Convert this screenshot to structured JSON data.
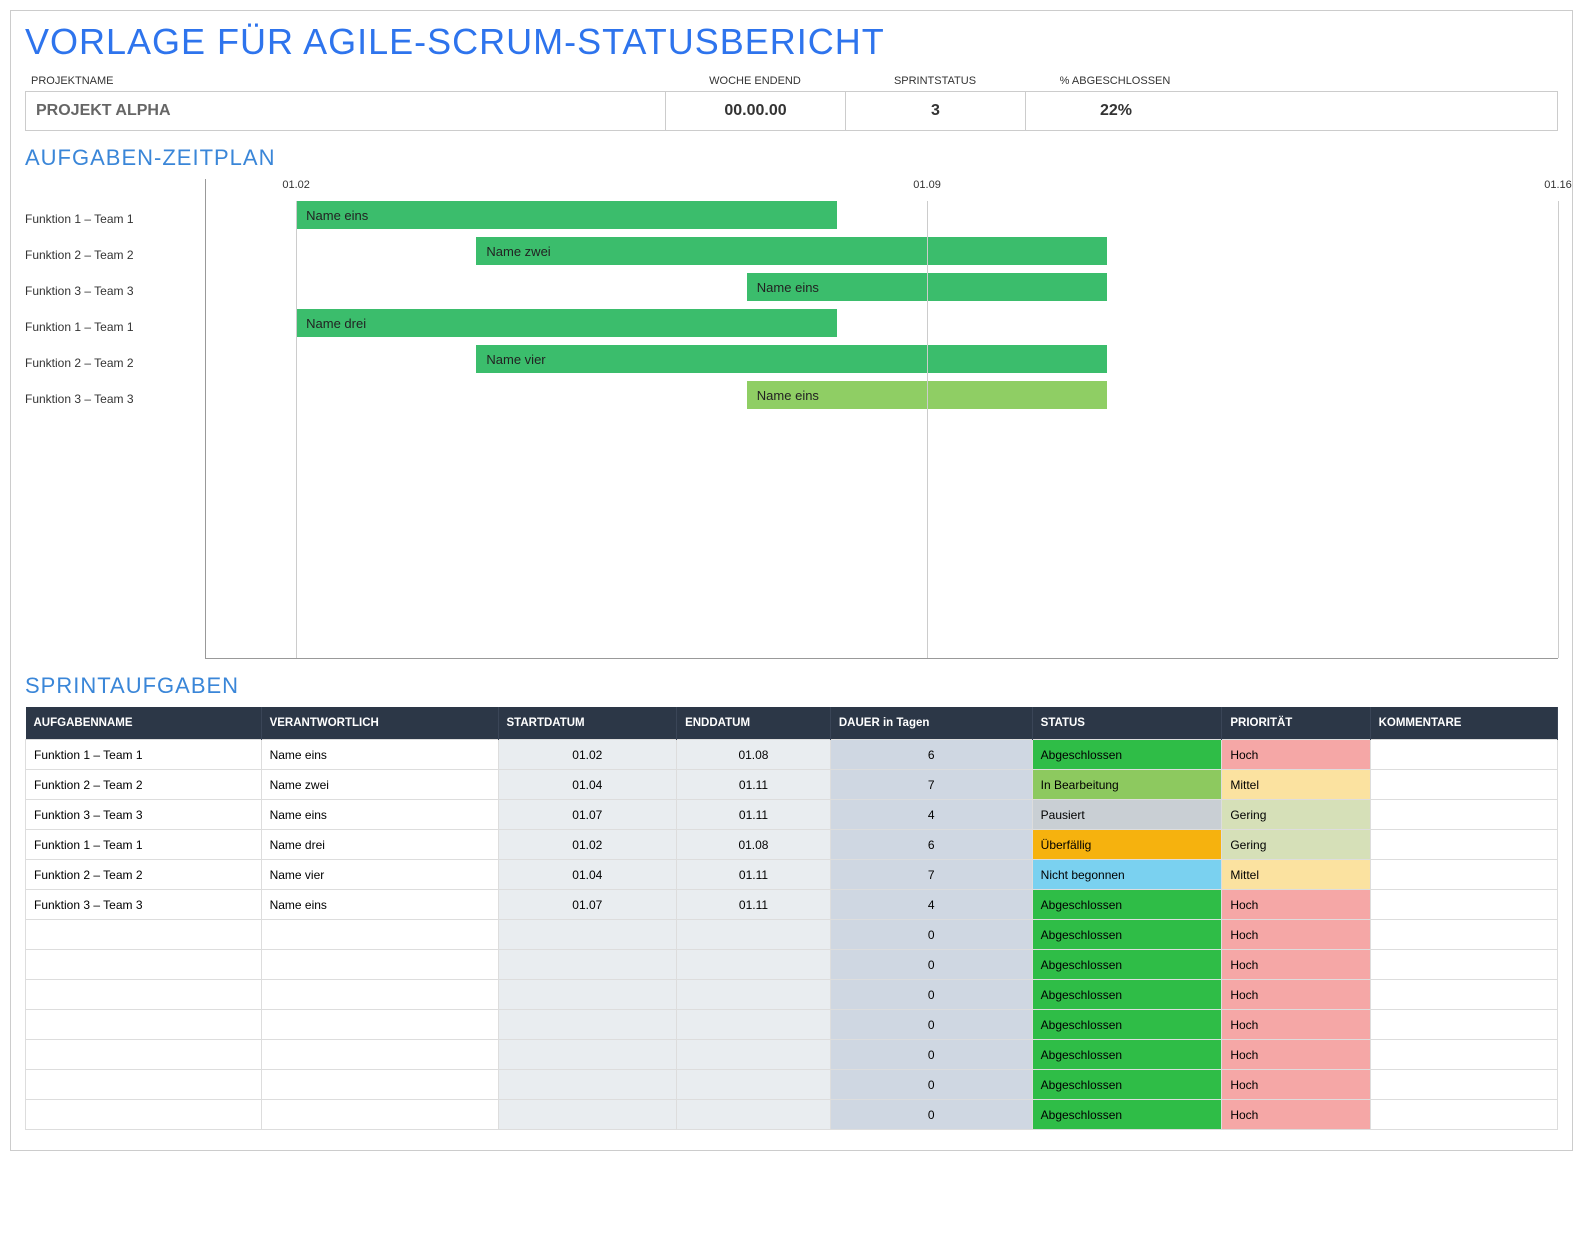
{
  "title": "VORLAGE FÜR AGILE-SCRUM-STATUSBERICHT",
  "summary": {
    "labels": {
      "project": "PROJEKTNAME",
      "week": "WOCHE ENDEND",
      "sprint": "SPRINTSTATUS",
      "pct": "% ABGESCHLOSSEN"
    },
    "values": {
      "project": "PROJEKT ALPHA",
      "week": "00.00.00",
      "sprint": "3",
      "pct": "22%"
    }
  },
  "sections": {
    "schedule": "AUFGABEN-ZEITPLAN",
    "tasks": "SPRINTAUFGABEN"
  },
  "chart_data": {
    "type": "bar",
    "xlabel": "",
    "ylabel": "",
    "x_ticks": [
      "01.02",
      "01.09",
      "01.16"
    ],
    "x_range": [
      1,
      16
    ],
    "categories": [
      "Funktion 1 – Team 1",
      "Funktion 2 – Team 2",
      "Funktion 3 – Team 3",
      "Funktion 1 – Team 1",
      "Funktion 2 – Team 2",
      "Funktion 3 – Team 3"
    ],
    "series": [
      {
        "name": "Name eins",
        "start": 2,
        "end": 8,
        "color": "#3bbd6c"
      },
      {
        "name": "Name zwei",
        "start": 4,
        "end": 11,
        "color": "#3bbd6c"
      },
      {
        "name": "Name eins",
        "start": 7,
        "end": 11,
        "color": "#3bbd6c"
      },
      {
        "name": "Name drei",
        "start": 2,
        "end": 8,
        "color": "#3bbd6c"
      },
      {
        "name": "Name vier",
        "start": 4,
        "end": 11,
        "color": "#3bbd6c"
      },
      {
        "name": "Name eins",
        "start": 7,
        "end": 11,
        "color": "#8fce64"
      }
    ]
  },
  "table": {
    "headers": [
      "AUFGABENNAME",
      "VERANTWORTLICH",
      "STARTDATUM",
      "ENDDATUM",
      "DAUER in Tagen",
      "STATUS",
      "PRIORITÄT",
      "KOMMENTARE"
    ],
    "rows": [
      {
        "name": "Funktion 1 – Team 1",
        "owner": "Name eins",
        "start": "01.02",
        "end": "01.08",
        "dur": "6",
        "status": "Abgeschlossen",
        "prio": "Hoch"
      },
      {
        "name": "Funktion 2 – Team 2",
        "owner": "Name zwei",
        "start": "01.04",
        "end": "01.11",
        "dur": "7",
        "status": "In Bearbeitung",
        "prio": "Mittel"
      },
      {
        "name": "Funktion 3 – Team 3",
        "owner": "Name eins",
        "start": "01.07",
        "end": "01.11",
        "dur": "4",
        "status": "Pausiert",
        "prio": "Gering"
      },
      {
        "name": "Funktion 1 – Team 1",
        "owner": "Name drei",
        "start": "01.02",
        "end": "01.08",
        "dur": "6",
        "status": "Überfällig",
        "prio": "Gering"
      },
      {
        "name": "Funktion 2 – Team 2",
        "owner": "Name vier",
        "start": "01.04",
        "end": "01.11",
        "dur": "7",
        "status": "Nicht begonnen",
        "prio": "Mittel"
      },
      {
        "name": "Funktion 3 – Team 3",
        "owner": "Name eins",
        "start": "01.07",
        "end": "01.11",
        "dur": "4",
        "status": "Abgeschlossen",
        "prio": "Hoch"
      },
      {
        "name": "",
        "owner": "",
        "start": "",
        "end": "",
        "dur": "0",
        "status": "Abgeschlossen",
        "prio": "Hoch"
      },
      {
        "name": "",
        "owner": "",
        "start": "",
        "end": "",
        "dur": "0",
        "status": "Abgeschlossen",
        "prio": "Hoch"
      },
      {
        "name": "",
        "owner": "",
        "start": "",
        "end": "",
        "dur": "0",
        "status": "Abgeschlossen",
        "prio": "Hoch"
      },
      {
        "name": "",
        "owner": "",
        "start": "",
        "end": "",
        "dur": "0",
        "status": "Abgeschlossen",
        "prio": "Hoch"
      },
      {
        "name": "",
        "owner": "",
        "start": "",
        "end": "",
        "dur": "0",
        "status": "Abgeschlossen",
        "prio": "Hoch"
      },
      {
        "name": "",
        "owner": "",
        "start": "",
        "end": "",
        "dur": "0",
        "status": "Abgeschlossen",
        "prio": "Hoch"
      },
      {
        "name": "",
        "owner": "",
        "start": "",
        "end": "",
        "dur": "0",
        "status": "Abgeschlossen",
        "prio": "Hoch"
      }
    ]
  },
  "colors": {
    "status": {
      "Abgeschlossen": "#2fbd47",
      "In Bearbeitung": "#8dc95f",
      "Pausiert": "#c9cfd4",
      "Überfällig": "#f6b20e",
      "Nicht begonnen": "#7ad1f0"
    },
    "prio": {
      "Hoch": "#f5a7a6",
      "Mittel": "#fbe2a0",
      "Gering": "#d6e0b8"
    },
    "date_bg": "#e9edf0",
    "dur_bg": "#cfd7e2"
  }
}
